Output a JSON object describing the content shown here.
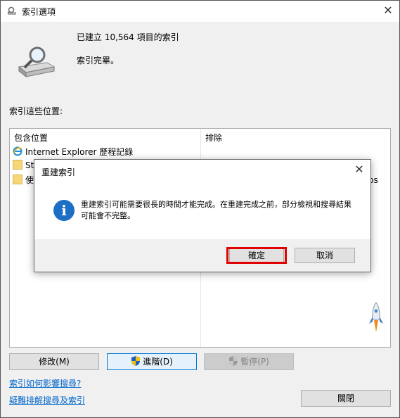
{
  "window": {
    "title": "索引選項",
    "close_symbol": "✕"
  },
  "status": {
    "indexed_summary": "已建立 10,564 項目的索引",
    "index_state": "索引完畢。"
  },
  "locations": {
    "section_label": "索引這些位置:",
    "col_included": "包含位置",
    "col_excluded": "排除",
    "rows": [
      {
        "name": "Internet Explorer 歷程記錄",
        "icon": "ie-icon"
      },
      {
        "name": "Sta",
        "icon": "folder-icon"
      },
      {
        "name": "使",
        "icon": "folder-icon"
      }
    ],
    "excluded_fragment": "ps"
  },
  "buttons": {
    "modify": "修改(M)",
    "advanced": "進階(D)",
    "pause": "暫停(P)",
    "close": "關閉"
  },
  "links": {
    "how_affects_search": "索引如何影響搜尋?",
    "troubleshoot": "疑難排解搜尋及索引"
  },
  "dialog": {
    "title": "重建索引",
    "close_symbol": "✕",
    "icon_glyph": "i",
    "message": "重建索引可能需要很長的時間才能完成。在重建完成之前，部分檢視和搜尋結果可能會不完整。",
    "ok": "確定",
    "cancel": "取消"
  },
  "colors": {
    "accent": "#0078d7",
    "highlight": "#e00000",
    "link": "#0066cc"
  }
}
